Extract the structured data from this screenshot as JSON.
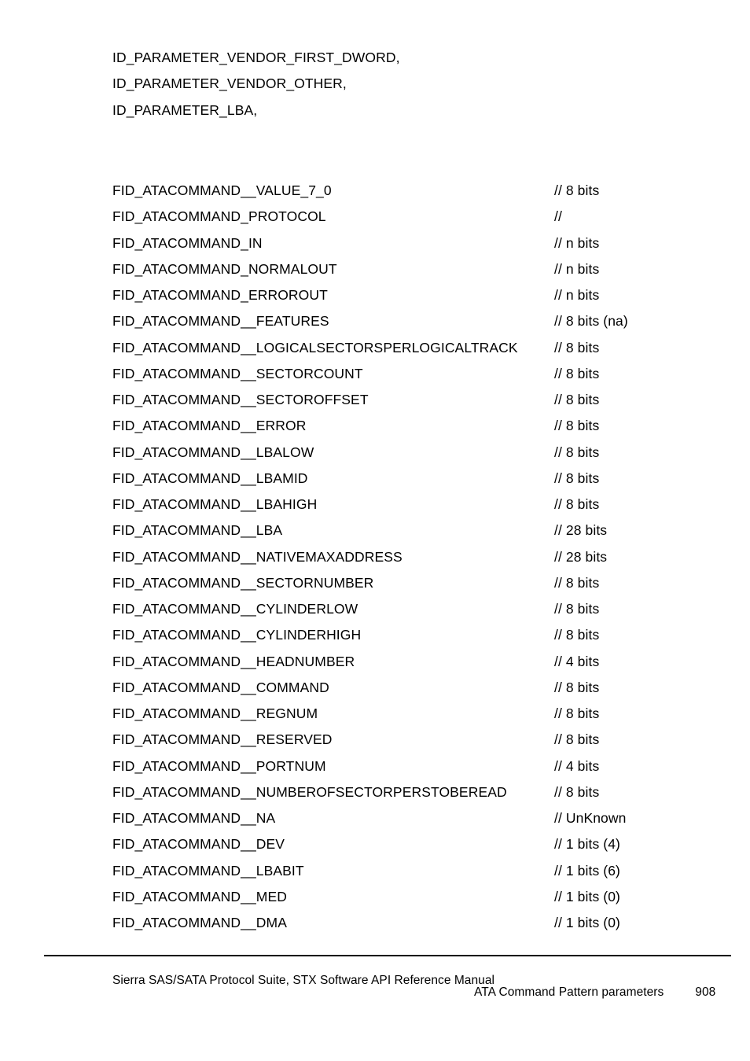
{
  "document": {
    "enum_lines": [
      "ID_PARAMETER_VENDOR_FIRST_DWORD,",
      "ID_PARAMETER_VENDOR_OTHER,",
      "ID_PARAMETER_LBA,"
    ],
    "fields": [
      {
        "name": "FID_ATACOMMAND__VALUE_7_0",
        "comment": "// 8 bits"
      },
      {
        "name": "FID_ATACOMMAND_PROTOCOL",
        "comment": "//"
      },
      {
        "name": "FID_ATACOMMAND_IN",
        "comment": "// n bits"
      },
      {
        "name": "FID_ATACOMMAND_NORMALOUT",
        "comment": "// n bits"
      },
      {
        "name": "FID_ATACOMMAND_ERROROUT",
        "comment": "// n bits"
      },
      {
        "name": "FID_ATACOMMAND__FEATURES",
        "comment": "// 8 bits (na)"
      },
      {
        "name": "FID_ATACOMMAND__LOGICALSECTORSPERLOGICALTRACK",
        "comment": "// 8 bits"
      },
      {
        "name": "FID_ATACOMMAND__SECTORCOUNT",
        "comment": "// 8 bits"
      },
      {
        "name": "FID_ATACOMMAND__SECTOROFFSET",
        "comment": "// 8 bits"
      },
      {
        "name": "FID_ATACOMMAND__ERROR",
        "comment": "// 8 bits"
      },
      {
        "name": "FID_ATACOMMAND__LBALOW",
        "comment": "// 8 bits"
      },
      {
        "name": "FID_ATACOMMAND__LBAMID",
        "comment": "// 8 bits"
      },
      {
        "name": "FID_ATACOMMAND__LBAHIGH",
        "comment": "// 8 bits"
      },
      {
        "name": "FID_ATACOMMAND__LBA",
        "comment": "// 28 bits"
      },
      {
        "name": "FID_ATACOMMAND__NATIVEMAXADDRESS",
        "comment": "// 28 bits"
      },
      {
        "name": "FID_ATACOMMAND__SECTORNUMBER",
        "comment": "// 8 bits"
      },
      {
        "name": "FID_ATACOMMAND__CYLINDERLOW",
        "comment": "// 8 bits"
      },
      {
        "name": "FID_ATACOMMAND__CYLINDERHIGH",
        "comment": "// 8 bits"
      },
      {
        "name": "FID_ATACOMMAND__HEADNUMBER",
        "comment": "// 4 bits"
      },
      {
        "name": "FID_ATACOMMAND__COMMAND",
        "comment": "// 8 bits"
      },
      {
        "name": "FID_ATACOMMAND__REGNUM",
        "comment": "// 8 bits"
      },
      {
        "name": "FID_ATACOMMAND__RESERVED",
        "comment": "// 8 bits"
      },
      {
        "name": "FID_ATACOMMAND__PORTNUM",
        "comment": "// 4 bits"
      },
      {
        "name": "FID_ATACOMMAND__NUMBEROFSECTORPERSTOBEREAD",
        "comment": "// 8 bits"
      },
      {
        "name": "FID_ATACOMMAND__NA",
        "comment": "// UnKnown"
      },
      {
        "name": "FID_ATACOMMAND__DEV",
        "comment": "// 1 bits (4)"
      },
      {
        "name": "FID_ATACOMMAND__LBABIT",
        "comment": "// 1 bits (6)"
      },
      {
        "name": "FID_ATACOMMAND__MED",
        "comment": "// 1 bits (0)"
      },
      {
        "name": "FID_ATACOMMAND__DMA",
        "comment": "// 1 bits (0)"
      }
    ]
  },
  "footer": {
    "manual_title": "Sierra SAS/SATA Protocol Suite, STX Software API Reference Manual",
    "section_title": "ATA Command Pattern parameters",
    "page_number": "908"
  }
}
